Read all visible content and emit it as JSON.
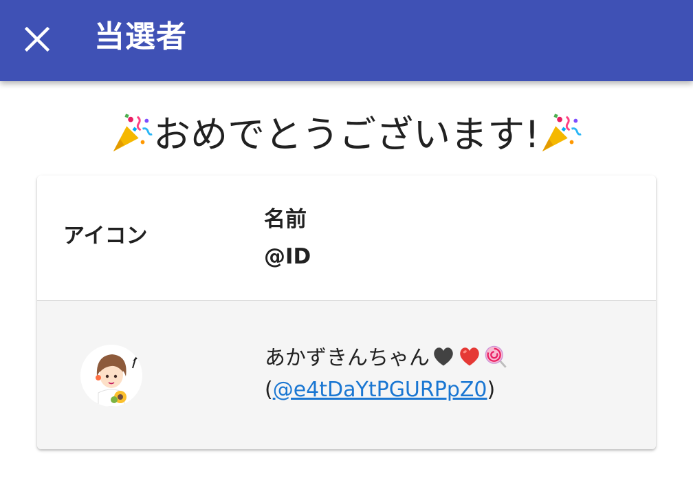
{
  "app_bar": {
    "title": "当選者",
    "close_icon": "close-icon",
    "background_color": "#3f51b5"
  },
  "congrats": {
    "text": "おめでとうございます!",
    "emoji_icon": "party-popper-icon"
  },
  "table": {
    "headers": {
      "icon": "アイコン",
      "name": "名前",
      "id": "@ID"
    },
    "rows": [
      {
        "avatar_icon": "user-avatar",
        "name": "あかずきんちゃん",
        "name_emojis": [
          "black-heart-icon",
          "red-heart-icon",
          "lollipop-icon"
        ],
        "id_open": "(",
        "id": "@e4tDaYtPGURPpZ0",
        "id_close": ")"
      }
    ]
  },
  "colors": {
    "link": "#1976d2",
    "row_background": "#f5f5f5"
  }
}
